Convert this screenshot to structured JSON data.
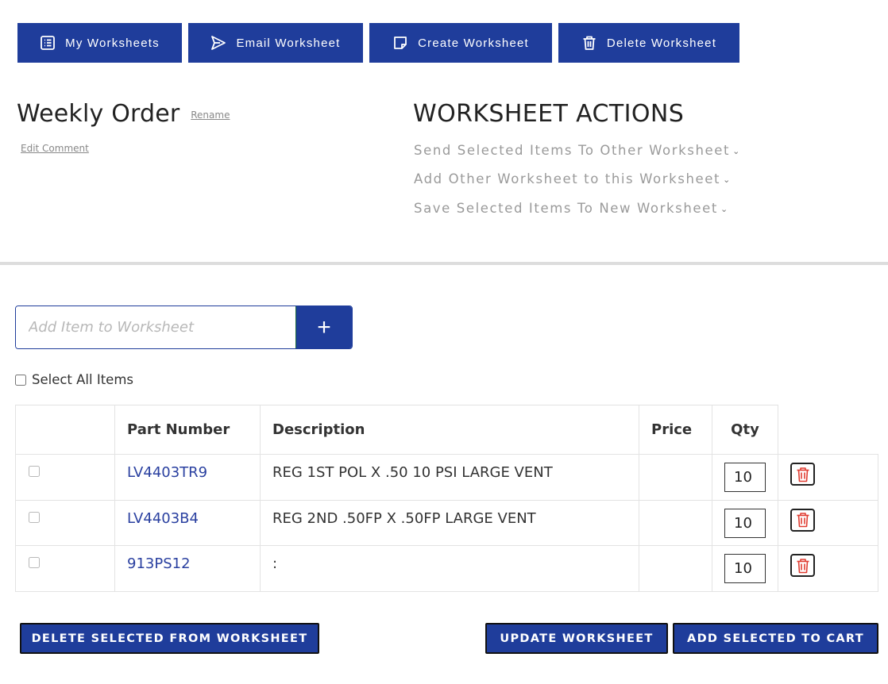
{
  "toolbar": {
    "my_worksheets": "My Worksheets",
    "email_worksheet": "Email Worksheet",
    "create_worksheet": "Create Worksheet",
    "delete_worksheet": "Delete Worksheet"
  },
  "worksheet": {
    "title": "Weekly Order",
    "rename_label": "Rename",
    "edit_comment_label": "Edit Comment"
  },
  "actions": {
    "heading": "WORKSHEET ACTIONS",
    "send_selected": "Send Selected Items To Other Worksheet",
    "add_other": "Add Other Worksheet to this Worksheet",
    "save_selected": "Save Selected Items To New Worksheet"
  },
  "add_item": {
    "placeholder": "Add Item to Worksheet",
    "button_label": "+"
  },
  "select_all_label": "Select All Items",
  "table": {
    "headers": {
      "part_number": "Part Number",
      "description": "Description",
      "price": "Price",
      "qty": "Qty"
    },
    "rows": [
      {
        "part_number": "LV4403TR9",
        "description": "REG 1ST POL X .50 10 PSI LARGE VENT",
        "price": "",
        "qty": "10"
      },
      {
        "part_number": "LV4403B4",
        "description": "REG 2ND .50FP X .50FP LARGE VENT",
        "price": "",
        "qty": "10"
      },
      {
        "part_number": "913PS12",
        "description": ":",
        "price": "",
        "qty": "10"
      }
    ]
  },
  "footer": {
    "delete_selected": "DELETE SELECTED FROM WORKSHEET",
    "update_worksheet": "UPDATE WORKSHEET",
    "add_to_cart": "ADD SELECTED TO CART"
  },
  "colors": {
    "primary": "#1f3d9b",
    "link": "#2a40a0",
    "trash": "#e03c31",
    "muted": "#9a9a9a"
  }
}
